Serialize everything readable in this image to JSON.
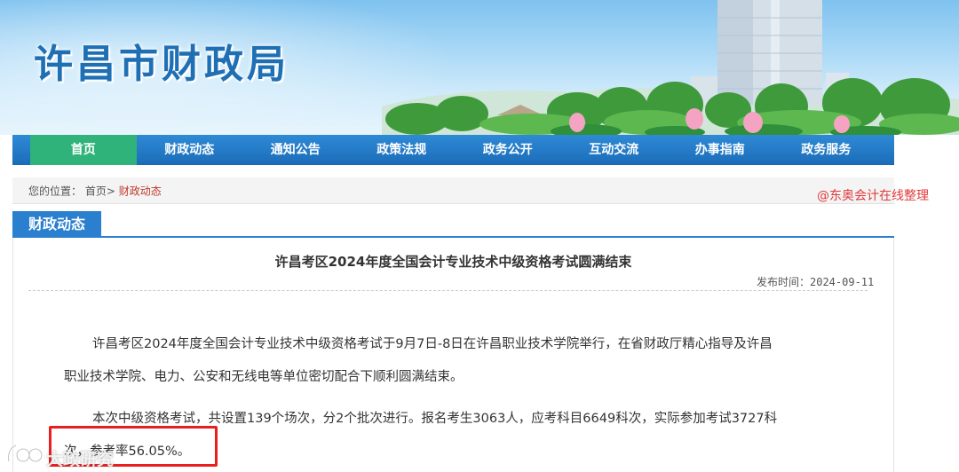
{
  "site": {
    "title": "许昌市财政局"
  },
  "nav": {
    "items": [
      {
        "label": "首页"
      },
      {
        "label": "财政动态"
      },
      {
        "label": "通知公告"
      },
      {
        "label": "政策法规"
      },
      {
        "label": "政务公开"
      },
      {
        "label": "互动交流"
      },
      {
        "label": "办事指南"
      },
      {
        "label": "政务服务"
      }
    ],
    "active_index": 0
  },
  "breadcrumb": {
    "prefix": "您的位置：",
    "home": "首页",
    "separator": ">",
    "current": "财政动态"
  },
  "watermark_note": "@东奥会计在线整理",
  "section": {
    "label": "财政动态"
  },
  "article": {
    "title": "许昌考区2024年度全国会计专业技术中级资格考试圆满结束",
    "published": "发布时间：2024-09-11",
    "paragraphs": [
      {
        "lines": [
          "许昌考区2024年度全国会计专业技术中级资格考试于9月7日-8日在许昌职业技术学院举行，在省财政厅精心指导及许昌",
          "职业技术学院、电力、公安和无线电等单位密切配合下顺利圆满结束。"
        ]
      },
      {
        "lines": [
          "本次中级资格考试，共设置139个场次，分2个批次进行。报名考生3063人，应考科目6649科次，实际参加考试3727科",
          "次，参考率56.05%。"
        ]
      }
    ]
  },
  "logo": {
    "text": "大政研究"
  },
  "colors": {
    "nav_bg": "#1a6cb8",
    "nav_active": "#2fb37a",
    "section_blue": "#2b7fcf",
    "highlight_red": "#e81f1f",
    "breadcrumb_current": "#c0392b"
  }
}
